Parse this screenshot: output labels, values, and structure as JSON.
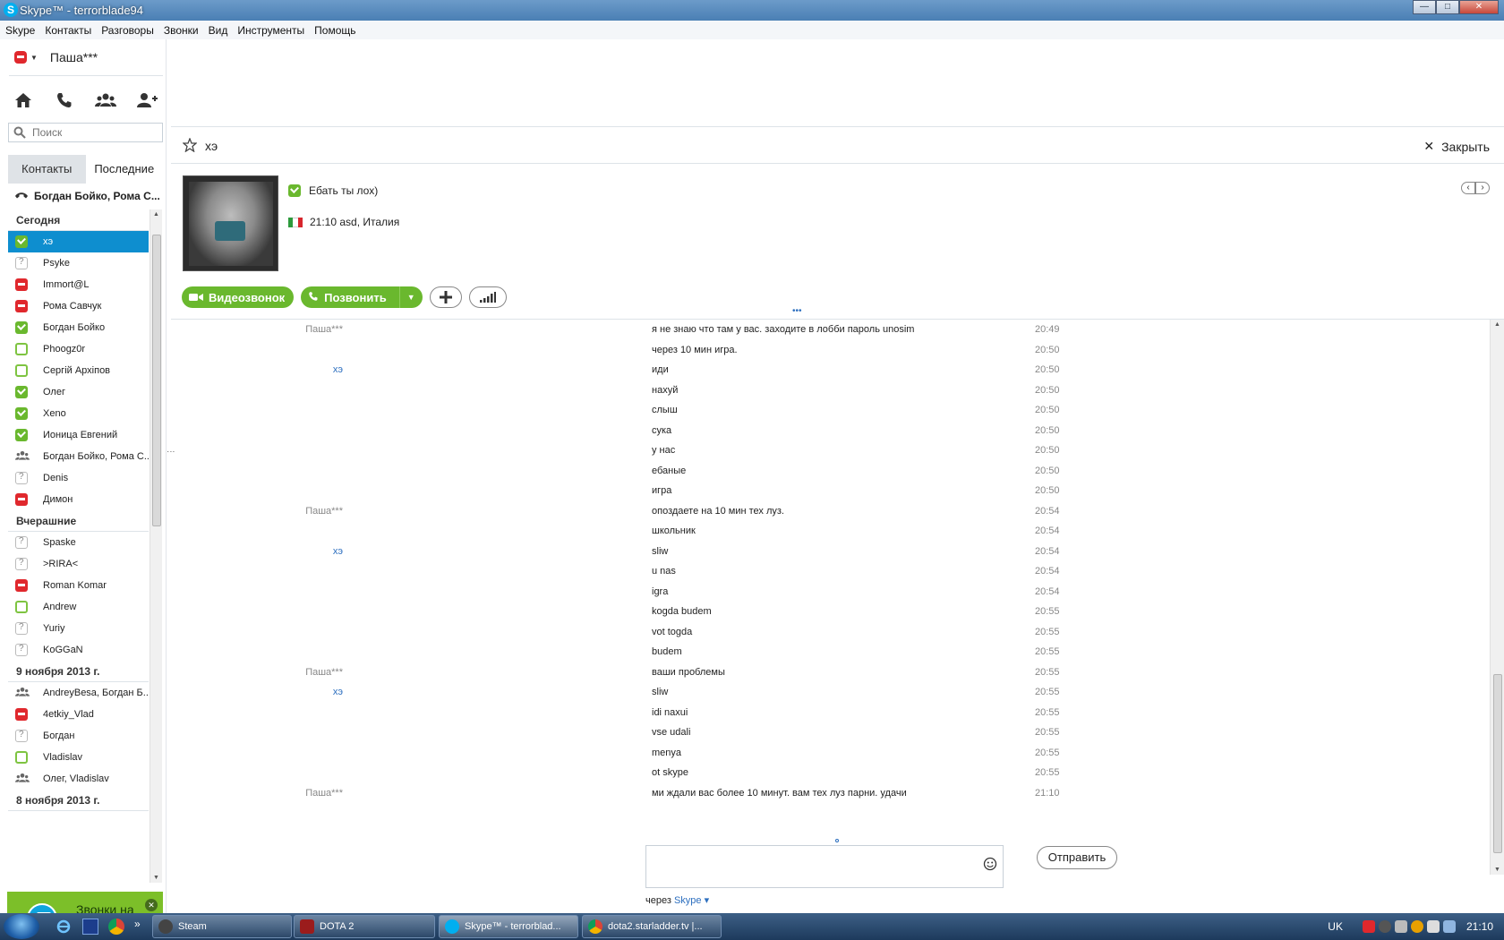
{
  "window": {
    "title": "Skype™ - terrorblade94",
    "logo_letter": "S",
    "controls": {
      "minimize": "—",
      "maximize": "□",
      "close": "✕"
    }
  },
  "menu": [
    "Skype",
    "Контакты",
    "Разговоры",
    "Звонки",
    "Вид",
    "Инструменты",
    "Помощь"
  ],
  "profile": {
    "name": "Паша***",
    "status": "away"
  },
  "nav_icons": [
    "home-icon",
    "phone-icon",
    "contacts-icon",
    "add-contact-icon"
  ],
  "search": {
    "placeholder": "Поиск",
    "value": ""
  },
  "tabs": {
    "contacts": "Контакты",
    "recent": "Последние",
    "active": "recent"
  },
  "recent_call": "Богдан Бойко, Рома С...",
  "groups": [
    {
      "label": "Сегодня",
      "items": [
        {
          "name": "хэ",
          "status": "online",
          "selected": true
        },
        {
          "name": "Psyke",
          "status": "unknown"
        },
        {
          "name": "Immort@L",
          "status": "away"
        },
        {
          "name": "Рома Савчук",
          "status": "away"
        },
        {
          "name": "Богдан Бойко",
          "status": "online"
        },
        {
          "name": "Phoogz0r",
          "status": "offline"
        },
        {
          "name": "Сергій Архіпов",
          "status": "offline"
        },
        {
          "name": "Олег",
          "status": "online"
        },
        {
          "name": "Xeno",
          "status": "online"
        },
        {
          "name": "Ионица Евгений",
          "status": "online"
        },
        {
          "name": "Богдан Бойко, Рома С...",
          "status": "group"
        },
        {
          "name": "Denis",
          "status": "unknown"
        },
        {
          "name": "Димон",
          "status": "away"
        }
      ]
    },
    {
      "label": "Вчерашние",
      "items": [
        {
          "name": "Spaske",
          "status": "unknown"
        },
        {
          "name": ">RIRA<",
          "status": "unknown"
        },
        {
          "name": "Roman Komar",
          "status": "away"
        },
        {
          "name": "Andrew",
          "status": "offline"
        },
        {
          "name": "Yuriy",
          "status": "unknown"
        },
        {
          "name": "KoGGaN",
          "status": "unknown"
        }
      ]
    },
    {
      "label": "9 ноября 2013 г.",
      "items": [
        {
          "name": "AndreyBesa, Богдан Б...",
          "status": "group"
        },
        {
          "name": "4etkiy_Vlad",
          "status": "away"
        },
        {
          "name": "Богдан",
          "status": "unknown"
        },
        {
          "name": "Vladislav",
          "status": "offline"
        },
        {
          "name": "Олег, Vladislav",
          "status": "group"
        }
      ]
    },
    {
      "label": "8 ноября 2013 г.",
      "items": []
    }
  ],
  "promo": {
    "text": "Звонки на стациона..."
  },
  "conversation": {
    "title": "хэ",
    "close_label": "Закрыть",
    "mood": "Ебать ты лох)",
    "location": "21:10 asd, Италия",
    "buttons": {
      "video": "Видеозвонок",
      "call": "Позвонить"
    }
  },
  "messages": [
    {
      "sender": "Паша***",
      "text": "я не знаю что там у вас. заходите в лобби пароль unosim",
      "time": "20:49",
      "self": true
    },
    {
      "sender": "",
      "text": "через 10 мин игра.",
      "time": "20:50",
      "self": true
    },
    {
      "sender": "хэ",
      "text": "иди",
      "time": "20:50",
      "self": false
    },
    {
      "sender": "",
      "text": "нахуй",
      "time": "20:50",
      "self": false
    },
    {
      "sender": "",
      "text": "слыш",
      "time": "20:50",
      "self": false
    },
    {
      "sender": "",
      "text": "сука",
      "time": "20:50",
      "self": false
    },
    {
      "sender": "",
      "text": "у нас",
      "time": "20:50",
      "self": false
    },
    {
      "sender": "",
      "text": "ебаные",
      "time": "20:50",
      "self": false
    },
    {
      "sender": "",
      "text": "игра",
      "time": "20:50",
      "self": false
    },
    {
      "sender": "Паша***",
      "text": "опоздаете на 10 мин тех луз.",
      "time": "20:54",
      "self": true
    },
    {
      "sender": "",
      "text": "школьник",
      "time": "20:54",
      "self": true
    },
    {
      "sender": "хэ",
      "text": "sliw",
      "time": "20:54",
      "self": false
    },
    {
      "sender": "",
      "text": "u nas",
      "time": "20:54",
      "self": false
    },
    {
      "sender": "",
      "text": "igra",
      "time": "20:54",
      "self": false
    },
    {
      "sender": "",
      "text": "kogda budem",
      "time": "20:55",
      "self": false
    },
    {
      "sender": "",
      "text": "vot togda",
      "time": "20:55",
      "self": false
    },
    {
      "sender": "",
      "text": "budem",
      "time": "20:55",
      "self": false
    },
    {
      "sender": "Паша***",
      "text": "ваши проблемы",
      "time": "20:55",
      "self": true
    },
    {
      "sender": "хэ",
      "text": "sliw",
      "time": "20:55",
      "self": false
    },
    {
      "sender": "",
      "text": "idi naxui",
      "time": "20:55",
      "self": false
    },
    {
      "sender": "",
      "text": "vse udali",
      "time": "20:55",
      "self": false
    },
    {
      "sender": "",
      "text": "menya",
      "time": "20:55",
      "self": false
    },
    {
      "sender": "",
      "text": "ot skype",
      "time": "20:55",
      "self": false
    },
    {
      "sender": "Паша***",
      "text": "ми ждали вас более 10 минут. вам тех луз парни. удачи",
      "time": "21:10",
      "self": true
    }
  ],
  "compose": {
    "value": "",
    "send_label": "Отправить",
    "via_prefix": "через",
    "via_link": "Skype ▾"
  },
  "taskbar": {
    "windows": [
      {
        "label": "Steam",
        "active": false
      },
      {
        "label": "DOTA 2",
        "active": false
      },
      {
        "label": "Skype™ - terrorblad...",
        "active": true
      },
      {
        "label": "dota2.starladder.tv |...",
        "active": false
      }
    ],
    "language": "UK",
    "clock": "21:10"
  },
  "colors": {
    "skype_green": "#6ab82e",
    "selection_blue": "#0e8ecf",
    "away_red": "#e0282d",
    "link_blue": "#2d6fbf"
  }
}
